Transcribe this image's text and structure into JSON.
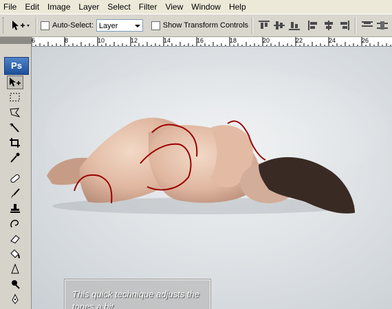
{
  "menu": [
    "File",
    "Edit",
    "Image",
    "Layer",
    "Select",
    "Filter",
    "View",
    "Window",
    "Help"
  ],
  "options": {
    "auto_select_label": "Auto-Select:",
    "auto_select_checked": false,
    "auto_select_value": "Layer",
    "show_transform_label": "Show Transform Controls",
    "show_transform_checked": false
  },
  "toolbox": {
    "logo_text": "Ps",
    "tools": [
      "move-tool",
      "marquee-tool",
      "lasso-tool",
      "magic-wand-tool",
      "crop-tool",
      "eyedropper-tool",
      "healing-brush-tool",
      "brush-tool",
      "clone-stamp-tool",
      "history-brush-tool",
      "eraser-tool",
      "paint-bucket-tool",
      "blur-tool",
      "dodge-tool",
      "pen-tool"
    ]
  },
  "ruler": {
    "labels": [
      "6",
      "8",
      "10",
      "12",
      "14",
      "16",
      "18",
      "20",
      "22",
      "24",
      "26"
    ]
  },
  "caption": {
    "text": "This quick technique adjusts the tones a bit."
  }
}
